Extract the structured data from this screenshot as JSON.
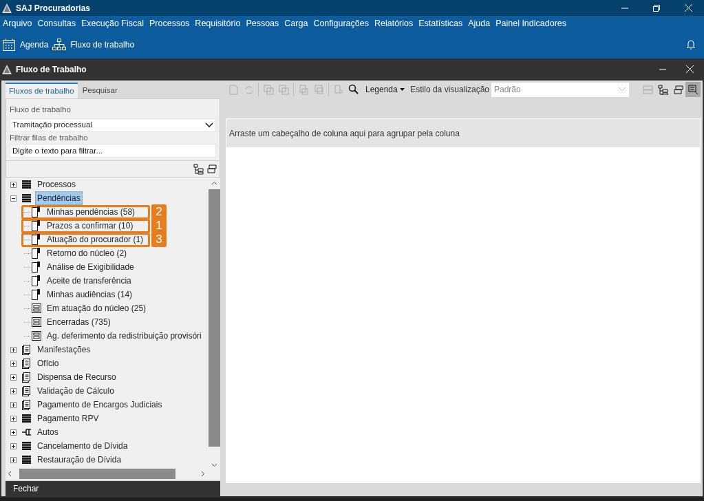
{
  "app": {
    "title": "SAJ Procuradorias"
  },
  "menu": [
    "Arquivo",
    "Consultas",
    "Execução Fiscal",
    "Processos",
    "Requisitório",
    "Pessoas",
    "Carga",
    "Configurações",
    "Relatórios",
    "Estatísticas",
    "Ajuda",
    "Painel Indicadores"
  ],
  "quick_actions": [
    {
      "label": "Agenda",
      "kind": "calendar"
    },
    {
      "label": "Fluxo de trabalho",
      "kind": "flow"
    }
  ],
  "window": {
    "title": "Fluxo de Trabalho"
  },
  "tabs": [
    {
      "label": "Fluxos de trabalho",
      "selected": true
    },
    {
      "label": "Pesquisar",
      "selected": false
    }
  ],
  "workflow": {
    "label": "Fluxo de trabalho",
    "value": "Tramitação processual"
  },
  "filter": {
    "label": "Filtrar filas de trabalho",
    "placeholder": "Digite o texto para filtrar..."
  },
  "tree": [
    {
      "label": "Processos",
      "kind": "list",
      "expanded": false,
      "selected": false
    },
    {
      "label": "Pendências",
      "kind": "list",
      "expanded": true,
      "selected": true,
      "children": [
        {
          "label": "Minhas pendências (58)",
          "kind": "queue",
          "selected": false,
          "callout": "2"
        },
        {
          "label": "Prazos a confirmar (10)",
          "kind": "queue",
          "selected": false,
          "callout": "1"
        },
        {
          "label": "Atuação do procurador (1)",
          "kind": "queue",
          "selected": false,
          "callout": "3"
        },
        {
          "label": "Retorno do núcleo (2)",
          "kind": "queue",
          "selected": false
        },
        {
          "label": "Análise de Exigibilidade",
          "kind": "queue",
          "selected": false
        },
        {
          "label": "Aceite de transferência",
          "kind": "queue",
          "selected": false
        },
        {
          "label": "Minhas audiências (14)",
          "kind": "queue",
          "selected": false
        },
        {
          "label": "Em atuação do núcleo (25)",
          "kind": "table",
          "selected": false
        },
        {
          "label": "Encerradas (735)",
          "kind": "table",
          "selected": false
        },
        {
          "label": "Ag. deferimento da redistribuição provisóri",
          "kind": "table",
          "selected": false
        }
      ]
    },
    {
      "label": "Manifestações",
      "kind": "clipboard",
      "expanded": false,
      "selected": false
    },
    {
      "label": "Ofício",
      "kind": "clipboard",
      "expanded": false,
      "selected": false
    },
    {
      "label": "Dispensa de Recurso",
      "kind": "clipboard",
      "expanded": false,
      "selected": false
    },
    {
      "label": "Validação de Cálculo",
      "kind": "clipboard",
      "expanded": false,
      "selected": false
    },
    {
      "label": "Pagamento de Encargos Judiciais",
      "kind": "clipboard",
      "expanded": false,
      "selected": false
    },
    {
      "label": "Pagamento RPV",
      "kind": "list",
      "expanded": false,
      "selected": false
    },
    {
      "label": "Autos",
      "kind": "autos",
      "expanded": false,
      "selected": false
    },
    {
      "label": "Cancelamento de Dívida",
      "kind": "list",
      "expanded": false,
      "selected": false
    },
    {
      "label": "Restauração de Dívida",
      "kind": "list",
      "expanded": false,
      "selected": false
    }
  ],
  "close_button": "Fechar",
  "toolbar": {
    "legend": "Legenda",
    "view_style_label": "Estilo da visualização",
    "view_style_value": "Padrão"
  },
  "group_hint": "Arraste um cabeçalho de coluna aqui para agrupar pela coluna"
}
